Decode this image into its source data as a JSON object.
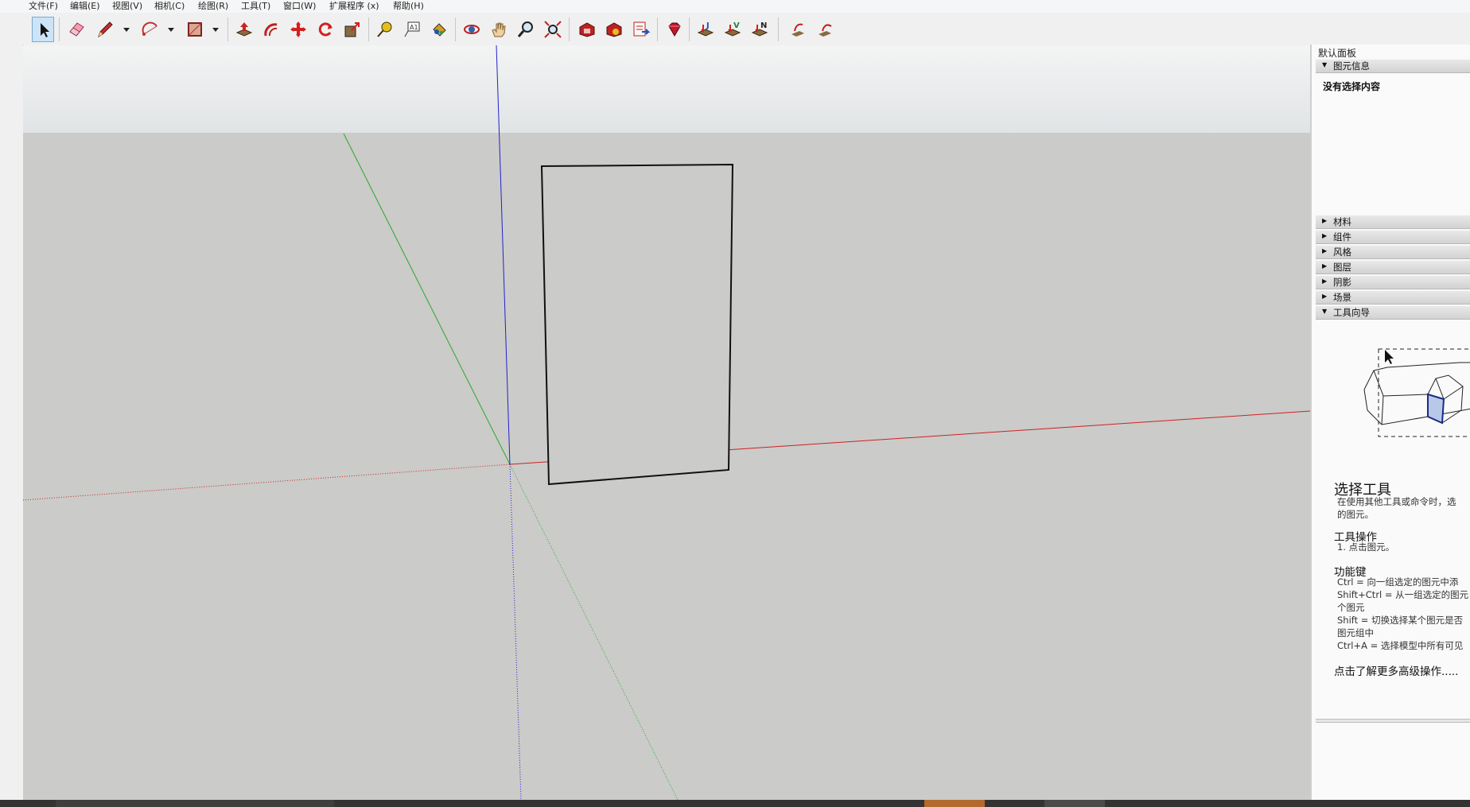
{
  "menu": [
    "文件(F)",
    "编辑(E)",
    "视图(V)",
    "相机(C)",
    "绘图(R)",
    "工具(T)",
    "窗口(W)",
    "扩展程序 (x)",
    "帮助(H)"
  ],
  "toolbar": {
    "select": "select-tool",
    "eraser": "eraser-tool",
    "pencil": "line-tool",
    "arc": "arc-tool",
    "rect": "rectangle-tool",
    "pushpull": "push-pull-tool",
    "offset": "offset-tool",
    "move": "move-tool",
    "rotate": "rotate-tool",
    "scale": "scale-tool",
    "tape": "tape-measure-tool",
    "text": "text-tool",
    "paint": "paint-bucket-tool",
    "orbit": "orbit-tool",
    "pan": "pan-tool",
    "zoom": "zoom-tool",
    "zoomext": "zoom-extents-tool",
    "warehouse": "3d-warehouse-icon",
    "extwarehouse": "extension-warehouse-icon",
    "share": "share-model-icon",
    "ruby": "ruby-console-icon",
    "plugin_j": "J",
    "plugin_v": "V",
    "plugin_n": "N"
  },
  "panel": {
    "title": "默认面板",
    "entity_info": {
      "label": "图元信息",
      "empty": "没有选择内容"
    },
    "sections": [
      "材料",
      "组件",
      "风格",
      "图层",
      "阴影",
      "场景"
    ],
    "instructor": {
      "label": "工具向导"
    }
  },
  "guide": {
    "title": "选择工具",
    "desc": [
      "在使用其他工具或命令时，选",
      "的图元。"
    ],
    "ops_heading": "工具操作",
    "ops": [
      "1. 点击图元。"
    ],
    "keys_heading": "功能键",
    "keys": [
      "Ctrl = 向一组选定的图元中添",
      "Shift+Ctrl = 从一组选定的图元",
      "个图元",
      "Shift = 切换选择某个图元是否",
      "图元组中",
      "Ctrl+A = 选择模型中所有可见"
    ],
    "more": "点击了解更多高级操作....."
  },
  "colors": {
    "sky_top": "#f3f4f4",
    "sky_bottom": "#e1e4e6",
    "ground": "#cbcbc9",
    "red_axis": "#cc2222",
    "green_axis": "#22aa22",
    "blue_axis": "#2222cc"
  }
}
